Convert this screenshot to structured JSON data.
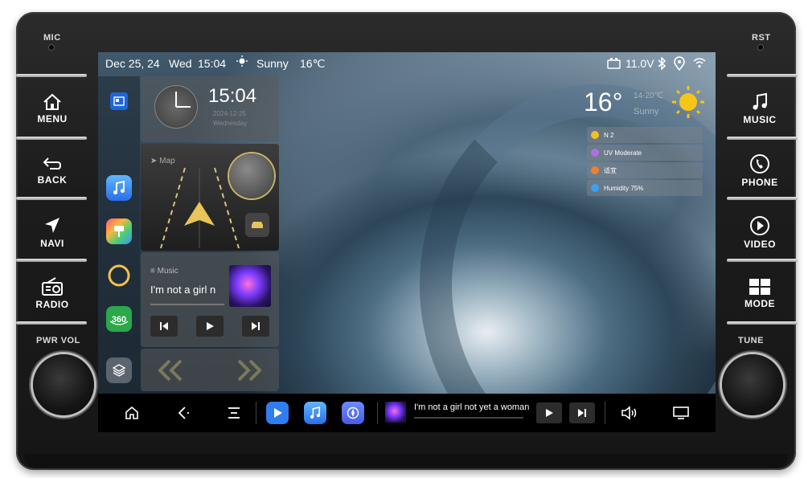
{
  "hardware": {
    "mic_label": "MIC",
    "rst_label": "RST",
    "pwr_vol_label": "PWR VOL",
    "tune_label": "TUNE",
    "left_buttons": [
      {
        "label": "MENU",
        "icon": "home-icon"
      },
      {
        "label": "BACK",
        "icon": "back-arrow-icon"
      },
      {
        "label": "NAVI",
        "icon": "navigation-arrow-icon"
      },
      {
        "label": "RADIO",
        "icon": "radio-icon"
      }
    ],
    "right_buttons": [
      {
        "label": "MUSIC",
        "icon": "music-note-icon"
      },
      {
        "label": "PHONE",
        "icon": "phone-icon"
      },
      {
        "label": "VIDEO",
        "icon": "play-circle-icon"
      },
      {
        "label": "MODE",
        "icon": "grid-icon"
      }
    ]
  },
  "status_bar": {
    "date": "Dec 25, 24",
    "weekday": "Wed",
    "time": "15:04",
    "weather": "Sunny",
    "temperature": "16℃",
    "voltage": "11.0V"
  },
  "clock_widget": {
    "time": "15:04",
    "date": "2024-12-25",
    "weekday": "Wednesday"
  },
  "map_widget": {
    "label": "Map"
  },
  "music_widget": {
    "label": "Music",
    "track": "I'm not a girl n"
  },
  "weather_widget": {
    "temperature": "16°",
    "range": "14-20℃",
    "condition": "Sunny",
    "rows": [
      {
        "text": "N 2",
        "color": "#f0c020"
      },
      {
        "text": "UV Moderate",
        "color": "#b070e0"
      },
      {
        "text": "适宜",
        "color": "#f08030"
      },
      {
        "text": "Humidity 75%",
        "color": "#40a0f0"
      }
    ]
  },
  "bottom_bar": {
    "now_playing": "I'm not a girl not yet a woman"
  },
  "colors": {
    "accent_blue": "#3b8cf5",
    "music_gradient_start": "#4fa3ff",
    "sun": "#f5c518"
  }
}
